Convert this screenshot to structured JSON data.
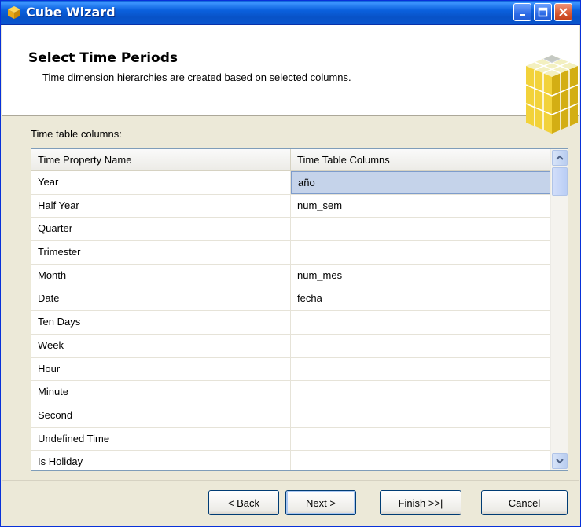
{
  "window": {
    "title": "Cube Wizard"
  },
  "header": {
    "title": "Select Time Periods",
    "subtitle": "Time dimension hierarchies are created based on selected columns."
  },
  "body": {
    "columns_label": "Time table columns:"
  },
  "grid": {
    "columns": [
      "Time Property Name",
      "Time Table Columns"
    ],
    "rows": [
      {
        "property": "Year",
        "column": "año",
        "selected": true
      },
      {
        "property": "Half Year",
        "column": "num_sem"
      },
      {
        "property": "Quarter",
        "column": ""
      },
      {
        "property": "Trimester",
        "column": ""
      },
      {
        "property": "Month",
        "column": "num_mes"
      },
      {
        "property": "Date",
        "column": "fecha"
      },
      {
        "property": "Ten Days",
        "column": ""
      },
      {
        "property": "Week",
        "column": ""
      },
      {
        "property": "Hour",
        "column": ""
      },
      {
        "property": "Minute",
        "column": ""
      },
      {
        "property": "Second",
        "column": ""
      },
      {
        "property": "Undefined Time",
        "column": ""
      },
      {
        "property": "Is Holiday",
        "column": ""
      }
    ]
  },
  "footer": {
    "back_label": "< Back",
    "next_label": "Next >",
    "finish_label": "Finish >>|",
    "cancel_label": "Cancel"
  },
  "colors": {
    "titlebar": "#0b61de",
    "window_face": "#ece9d8",
    "selection": "#c5d3ea",
    "close_button": "#d85a33"
  },
  "icons": {
    "title": "cube-icon",
    "header": "cube-graphic-icon",
    "minimize": "minimize-icon",
    "maximize": "maximize-icon",
    "close": "close-icon",
    "scroll_up": "scroll-up-icon",
    "scroll_down": "scroll-down-icon"
  }
}
